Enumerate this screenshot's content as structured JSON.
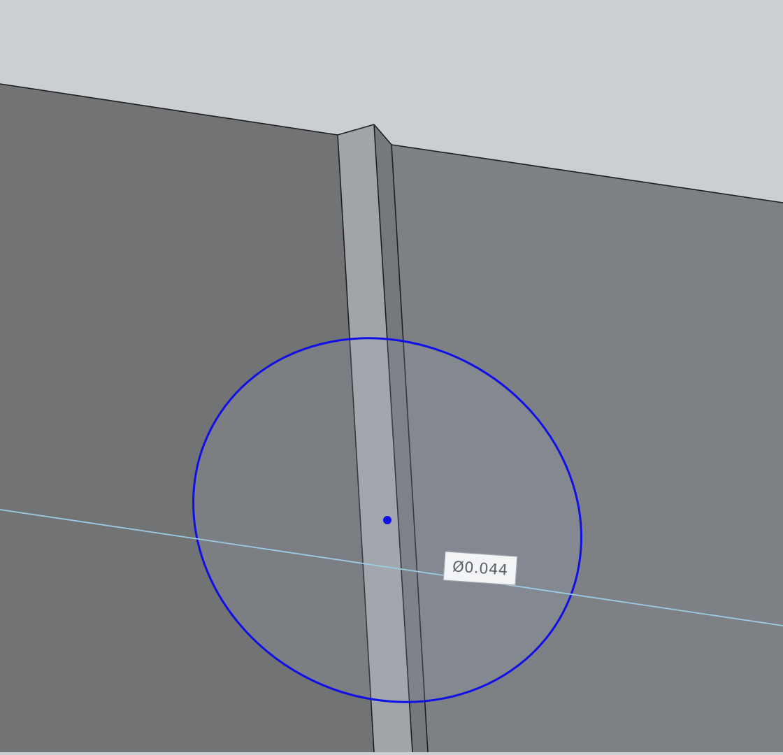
{
  "viewport": {
    "background_color": "#cbced2",
    "face_left_color": "#727374",
    "face_right_color": "#7d8185",
    "rib_front_color": "#a1a4a8",
    "rib_side_color": "#76797c",
    "edge_color": "#1f1f1f"
  },
  "sketch": {
    "circle_color": "#1010e6",
    "construction_line_color": "#9ccbe4",
    "center_point_color": "#1010e6",
    "dimension_label": "Ø0.044"
  }
}
